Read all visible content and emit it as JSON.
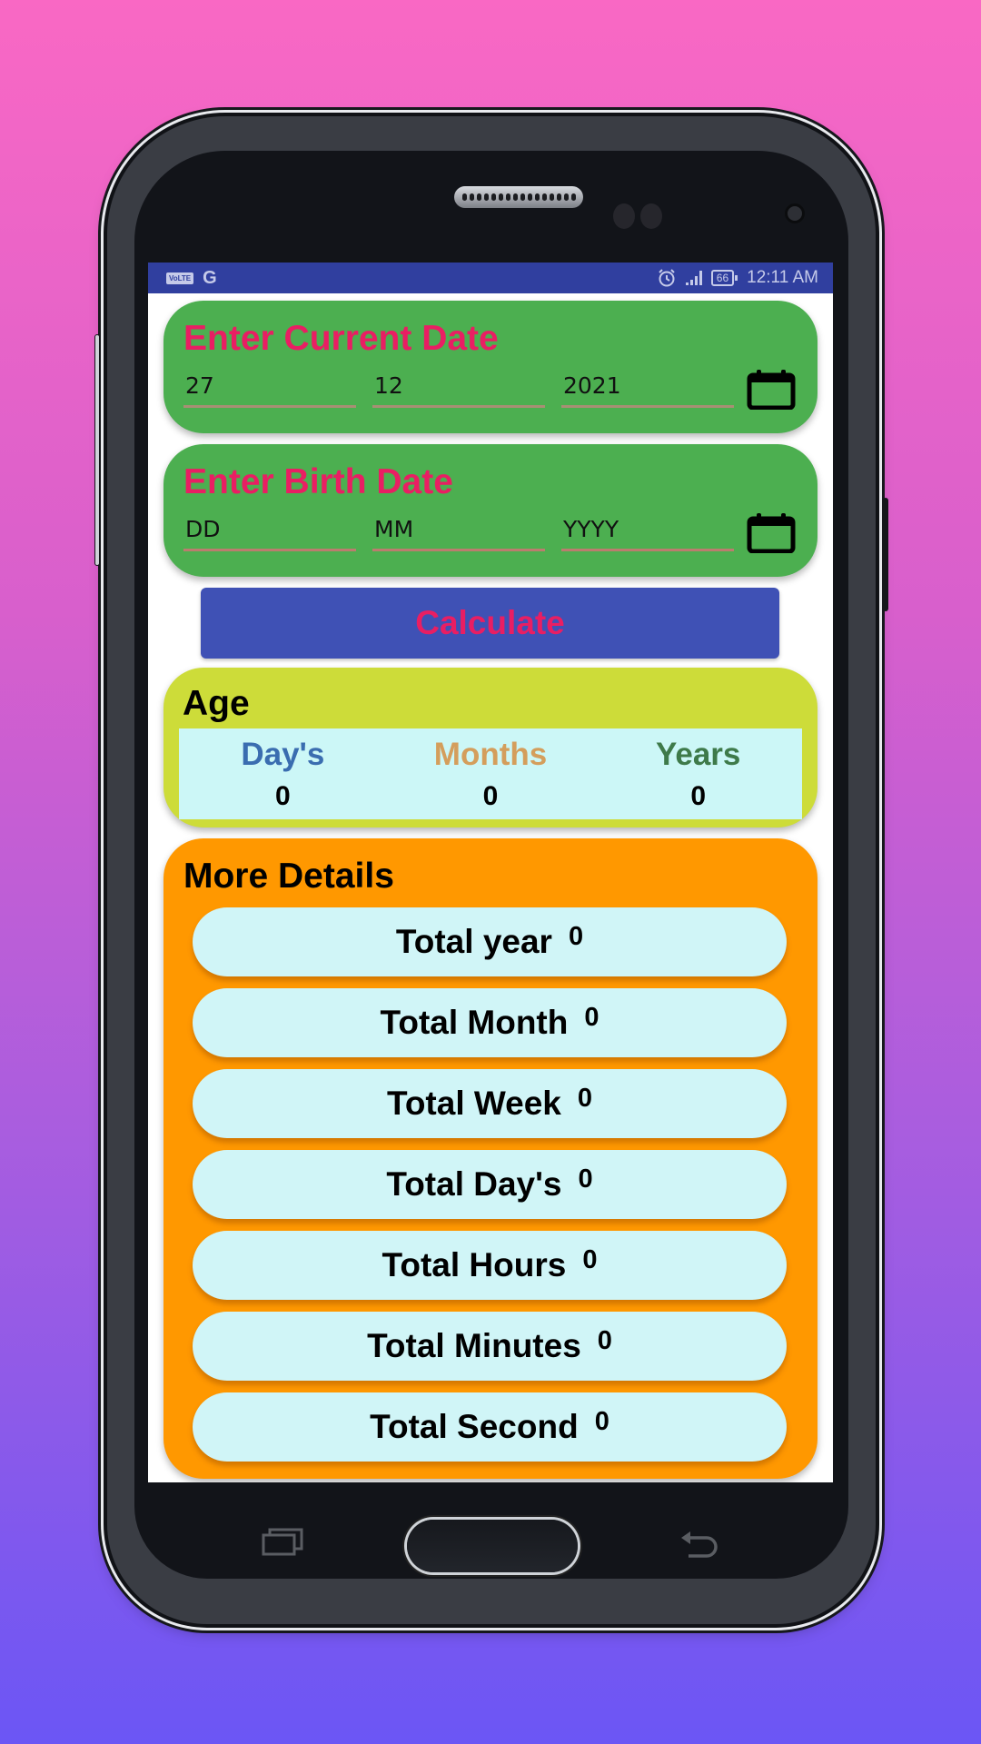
{
  "status_bar": {
    "network_badge": "VoLTE",
    "network_type": "G",
    "battery_level": "66",
    "time": "12:11 AM",
    "icons": [
      "alarm-icon",
      "signal-icon",
      "battery-icon"
    ]
  },
  "current_date": {
    "title": "Enter Current Date",
    "day": {
      "value": "27",
      "placeholder": "DD"
    },
    "month": {
      "value": "12",
      "placeholder": "MM"
    },
    "year": {
      "value": "2021",
      "placeholder": "YYYY"
    },
    "icon": "calendar-icon"
  },
  "birth_date": {
    "title": "Enter Birth Date",
    "day": {
      "value": "",
      "placeholder": "DD"
    },
    "month": {
      "value": "",
      "placeholder": "MM"
    },
    "year": {
      "value": "",
      "placeholder": "YYYY"
    },
    "icon": "calendar-icon"
  },
  "calculate_button": {
    "label": "Calculate"
  },
  "age": {
    "title": "Age",
    "columns": [
      {
        "label": "Day's",
        "value": "0",
        "color": "#3a6db0"
      },
      {
        "label": "Months",
        "value": "0",
        "color": "#d49e5c"
      },
      {
        "label": "Years",
        "value": "0",
        "color": "#3e7a4a"
      }
    ]
  },
  "more_details": {
    "title": "More Details",
    "items": [
      {
        "label": "Total year",
        "value": "0"
      },
      {
        "label": "Total Month",
        "value": "0"
      },
      {
        "label": "Total Week",
        "value": "0"
      },
      {
        "label": "Total Day's",
        "value": "0"
      },
      {
        "label": "Total Hours",
        "value": "0"
      },
      {
        "label": "Total Minutes",
        "value": "0"
      },
      {
        "label": "Total Second",
        "value": "0"
      }
    ]
  },
  "colors": {
    "status_bar": "#303f9f",
    "date_card": "#4caf50",
    "title_pink": "#e91e63",
    "button": "#3f51b5",
    "age_card": "#cddc39",
    "age_grid": "#ccf7f7",
    "details_card": "#ff9800",
    "pill": "#d0f5f7"
  },
  "nav_keys": [
    "recent-apps",
    "home",
    "back"
  ]
}
